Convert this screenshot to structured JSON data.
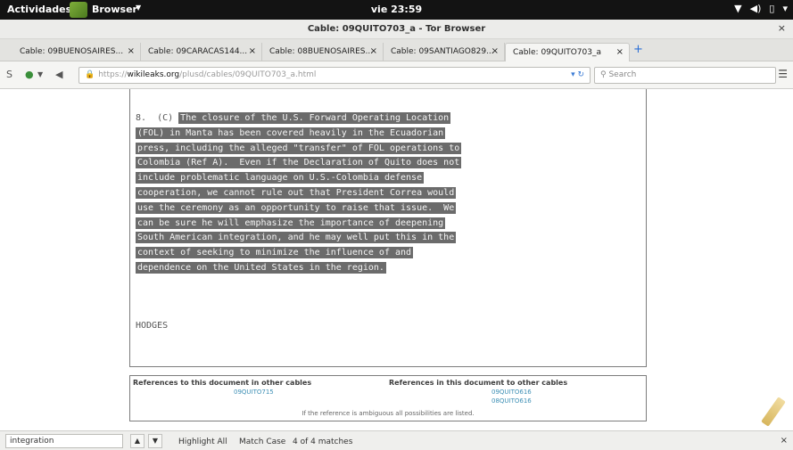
{
  "topbar": {
    "activities": "Actividades",
    "app_name": "Browser",
    "clock": "vie 23:59",
    "tray_network": "▼",
    "tray_volume": "◀)",
    "tray_battery": "▯",
    "tray_menu": "▾"
  },
  "window": {
    "title": "Cable: 09QUITO703_a - Tor Browser",
    "close_label": "×"
  },
  "tabs": [
    {
      "label": "Cable: 09BUENOSAIRES..."
    },
    {
      "label": "Cable: 09CARACAS144..."
    },
    {
      "label": "Cable: 08BUENOSAIRES..."
    },
    {
      "label": "Cable: 09SANTIAGO829..."
    },
    {
      "label": "Cable: 09QUITO703_a"
    }
  ],
  "tab_close_label": "×",
  "newtab_label": "+",
  "navbar": {
    "url_scheme": "https://",
    "url_host": "wikileaks.org",
    "url_path": "/plusd/cables/09QUITO703_a.html",
    "search_placeholder": "Search"
  },
  "cable": {
    "lines": [
      {
        "prefix": "8.  (C) ",
        "text": "The closure of the U.S. Forward Operating Location"
      },
      {
        "prefix": "",
        "text": "(FOL) in Manta has been covered heavily in the Ecuadorian"
      },
      {
        "prefix": "",
        "text": "press, including the alleged \"transfer\" of FOL operations to"
      },
      {
        "prefix": "",
        "text": "Colombia (Ref A).  Even if the Declaration of Quito does not"
      },
      {
        "prefix": "",
        "text": "include problematic language on U.S.-Colombia defense"
      },
      {
        "prefix": "",
        "text": "cooperation, we cannot rule out that President Correa would"
      },
      {
        "prefix": "",
        "text": "use the ceremony as an opportunity to raise that issue.  We"
      },
      {
        "prefix": "",
        "text": "can be sure he will emphasize the importance of deepening"
      },
      {
        "prefix": "",
        "text": "South American integration, and he may well put this in the"
      },
      {
        "prefix": "",
        "text": "context of seeking to minimize the influence of and"
      },
      {
        "prefix": "",
        "text": "dependence on the United States in the region."
      }
    ],
    "signoff": "HODGES"
  },
  "references": {
    "left_heading": "References to this document in other cables",
    "left_links": [
      "09QUITO715"
    ],
    "right_heading": "References in this document to other cables",
    "right_links": [
      "09QUITO616",
      "08QUITO616"
    ],
    "note": "If the reference is ambiguous all possibilities are listed."
  },
  "findbar": {
    "query": "integration",
    "highlight_all": "Highlight All",
    "match_case": "Match Case",
    "status": "4 of 4 matches",
    "prev_label": "▲",
    "next_label": "▼",
    "close_label": "×"
  },
  "colors": {
    "highlight_bg": "#6b6b6b",
    "link": "#3d8fb5",
    "topbar": "#131313"
  }
}
